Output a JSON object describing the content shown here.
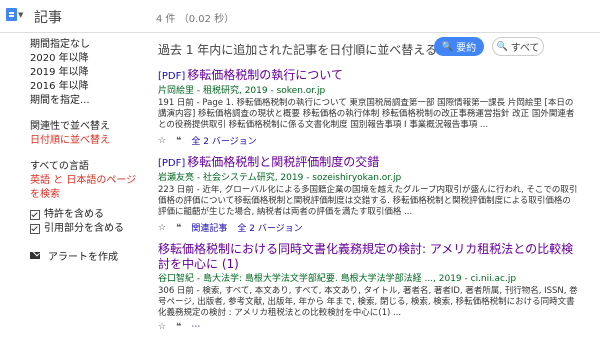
{
  "header": {
    "title": "記事",
    "count": "4 件 （0.02 秒）"
  },
  "sidebar": {
    "periods": [
      "期間指定なし",
      "2020 年以降",
      "2019 年以降",
      "2016 年以降",
      "期間を指定..."
    ],
    "sort": [
      "関連性で並べ替え",
      "日付順に並べ替え"
    ],
    "languages": [
      "すべての言語",
      "英語 と 日本語のページ",
      "を検索"
    ],
    "checks": [
      "特許を含める",
      "引用部分を含める"
    ],
    "alert": "アラートを作成"
  },
  "notice": "過去 1 年内に追加された記事を日付順に並べ替える",
  "buttons": {
    "summary": "要約",
    "all": "すべて"
  },
  "results": [
    {
      "tag": "[PDF]",
      "title": "移転価格税制の執行について",
      "source": "片岡絵里 - 租税研究, 2019 - soken.or.jp",
      "snippet": "191 日前 - Page 1. 移転価格税制の執行について 東京国税局調査第一部 国際情報第一課長 片岡絵里 [本日の講演内容] 移転価格調査の現状と概要 移転価格の執行体制 移転価格税制の改正事務運営指針 改正 国外関連者との役務提供取引 移転価格税制に係る文書化制度 国別報告事項 I 事業概況報告事項 ...",
      "actions": [
        "全 2 バージョン"
      ]
    },
    {
      "tag": "[PDF]",
      "title": "移転価格税制と関税評価制度の交錯",
      "source": "岩瀬友亮 - 社会システム研究, 2019 - sozeishiryokan.or.jp",
      "snippet": "223 日前 - 近年, グローバル化による多国籍企業の国境を越えたグループ内取引が盛んに行われ, そこでの取引価格の評価について移転価格税制と関税評価制度は交錯する. 移転価格税制と関税評価制度による取引価格の評価に齟齬が生じた場合, 納税者は両者の評価を満たす取引価格 ...",
      "actions": [
        "関連記事",
        "全 2 バージョン"
      ]
    },
    {
      "tag": "",
      "title": "移転価格税制における同時文書化義務規定の検討: アメリカ租税法との比較検討を中心に (1)",
      "source": "谷口智紀 - 島大法学: 島根大学法文学部紀要. 島根大学法学部法経 ..., 2019 - ci.nii.ac.jp",
      "snippet": "306 日前 - 検索, すべて, 本文あり, すべて, 本文あり, タイトル, 著者名, 著者ID, 著者所属, 刊行物名, ISSN, 巻号ページ, 出版者, 参考文献, 出版年, 年から 年まで, 検索, 閉じる, 検索, 検索, 移転価格税制における同時文書化義務規定の検討 : アメリカ租税法との比較検討を中心に(1) ...",
      "actions": []
    }
  ]
}
